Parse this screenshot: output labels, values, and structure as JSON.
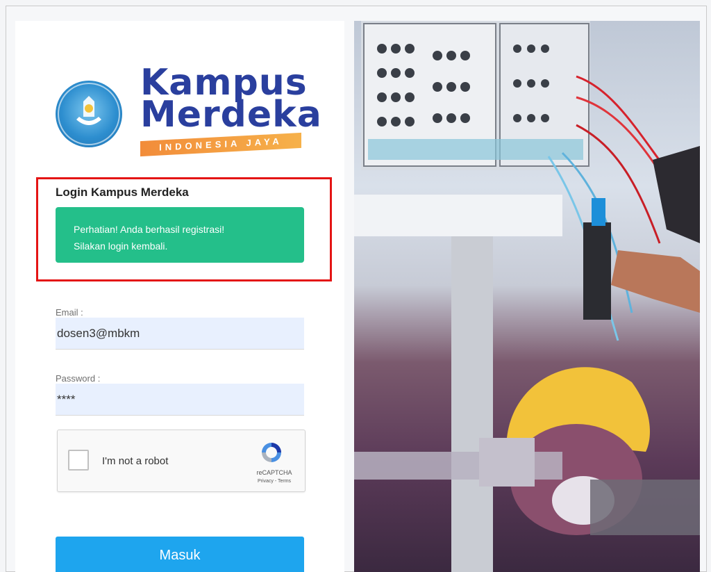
{
  "logo": {
    "line1": "Kampus",
    "line2": "Merdeka",
    "tagline": "INDONESIA JAYA",
    "colors": {
      "text": "#2a3f9e",
      "ribbon": "#f28c3a"
    }
  },
  "login": {
    "title": "Login Kampus Merdeka",
    "alert_line1": "Perhatian! Anda berhasil registrasi!",
    "alert_line2": "Silakan login kembali.",
    "alert_color": "#24bf8a",
    "highlight_color": "#e41414"
  },
  "form": {
    "email_label": "Email :",
    "email_value": "dosen3@mbkm",
    "password_label": "Password :",
    "password_value": "****",
    "submit_label": "Masuk",
    "submit_color": "#1ea5ee"
  },
  "recaptcha": {
    "checkbox_label": "I'm not a robot",
    "brand": "reCAPTCHA",
    "links": "Privacy - Terms",
    "icon": "recaptcha-icon"
  },
  "hero": {
    "icon": "hero-photo-icon"
  }
}
